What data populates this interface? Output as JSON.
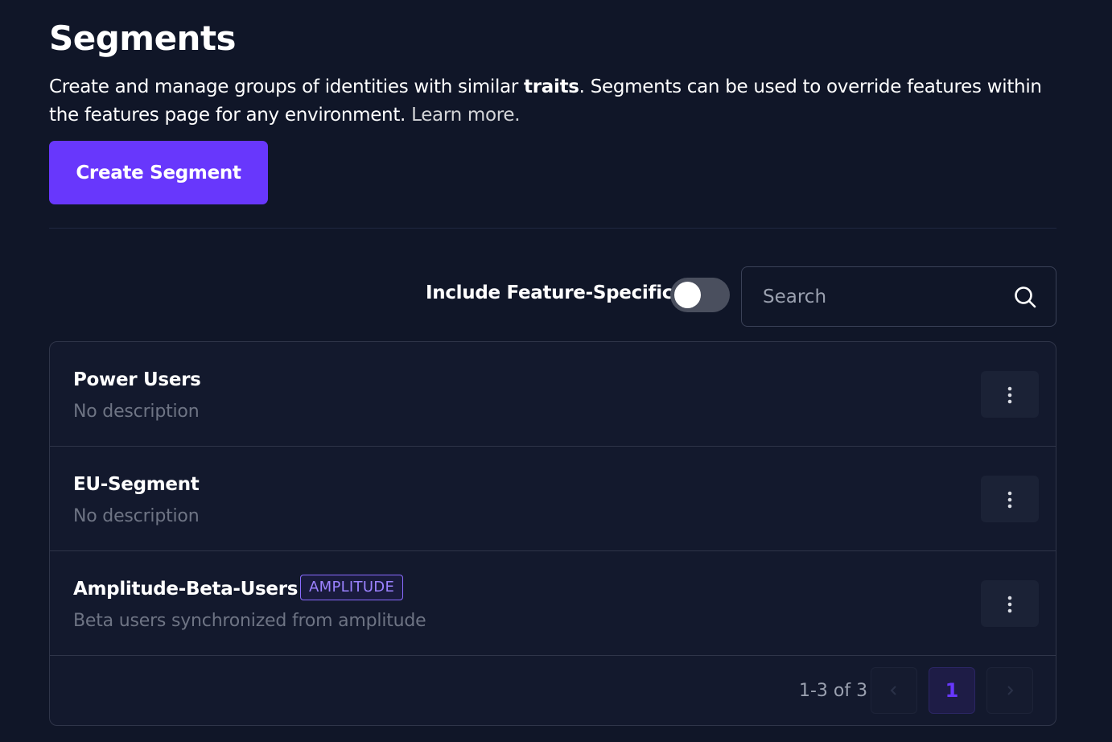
{
  "header": {
    "title": "Segments",
    "desc_prefix": "Create and manage groups of identities with similar ",
    "desc_bold": "traits",
    "desc_suffix": ". Segments can be used to override features within the features page for any environment. ",
    "learn_more": "Learn more."
  },
  "actions": {
    "create_label": "Create Segment",
    "toggle_label": "Include Feature-Specific",
    "toggle_on": false,
    "search_placeholder": "Search"
  },
  "segments": [
    {
      "name": "Power Users",
      "description": "No description"
    },
    {
      "name": "EU-Segment",
      "description": "No description"
    },
    {
      "name": "Amplitude-Beta-Users",
      "description": "Beta users synchronized from amplitude",
      "tag": "AMPLITUDE"
    }
  ],
  "pagination": {
    "range": "1-3 of 3",
    "current_page": "1"
  },
  "colors": {
    "background": "#101628",
    "accent": "#6837fc",
    "tag": "#9b82ff"
  }
}
